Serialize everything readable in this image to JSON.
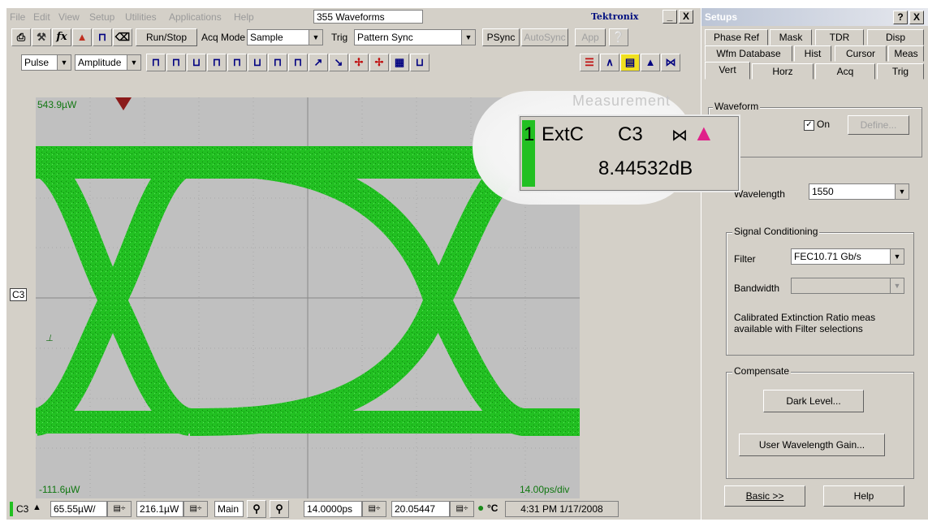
{
  "menu": [
    "File",
    "Edit",
    "View",
    "Setup",
    "Utilities",
    "Applications",
    "Help"
  ],
  "waveform_count": "355 Waveforms",
  "brand": "Tektronix",
  "window_controls": {
    "minimize": "_",
    "close": "X"
  },
  "toolbar": {
    "run_stop": "Run/Stop",
    "acq_mode_label": "Acq Mode",
    "acq_mode_value": "Sample",
    "trig_label": "Trig",
    "trig_value": "Pattern Sync",
    "psync": "PSync",
    "autosync": "AutoSync",
    "app": "App"
  },
  "meas_bar": {
    "category": "Pulse",
    "parameter": "Amplitude"
  },
  "plot": {
    "top_ref": "543.9µW",
    "bottom_ref": "-111.6µW",
    "timebase": "14.00ps/div",
    "channel_marker": "C3"
  },
  "readout": {
    "badge": "1",
    "source": "ExtC",
    "channel": "C3",
    "value": "8.44532dB"
  },
  "magnifier_bg_text": "Measurement",
  "status": {
    "channel": "C3",
    "scale": "65.55µW/",
    "offset": "216.1µW",
    "main": "Main",
    "time": "14.0000ps",
    "position": "20.05447",
    "temp_unit": "°C",
    "datetime": "4:31 PM 1/17/2008"
  },
  "setups": {
    "title": "Setups",
    "tabs_row1": [
      "Phase Ref",
      "Mask",
      "TDR",
      "Disp"
    ],
    "tabs_row2": [
      "Wfm Database",
      "Hist",
      "Cursor",
      "Meas"
    ],
    "tabs_row3": [
      "Vert",
      "Horz",
      "Acq",
      "Trig"
    ],
    "waveform_group": "Waveform",
    "on_label": "On",
    "define_button": "Define...",
    "wavelength_label": "Wavelength",
    "wavelength_value": "1550",
    "signal_group": "Signal Conditioning",
    "filter_label": "Filter",
    "filter_value": "FEC10.71 Gb/s",
    "bandwidth_label": "Bandwidth",
    "calibrated_note": "Calibrated Extinction Ratio meas available with Filter selections",
    "compensate_group": "Compensate",
    "dark_level_button": "Dark Level...",
    "user_gain_button": "User Wavelength Gain...",
    "basic_button": "Basic >>",
    "help_button": "Help"
  },
  "colors": {
    "trace": "#22c022",
    "plot_bg": "#c0c0c0",
    "marker": "#8b1a1a"
  }
}
